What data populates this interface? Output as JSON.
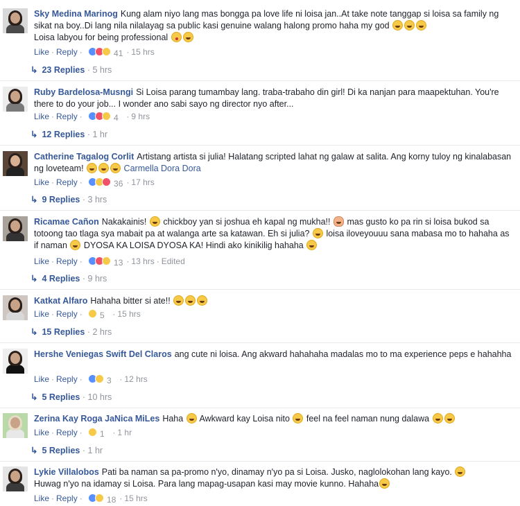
{
  "actions": {
    "like": "Like",
    "reply": "Reply",
    "dot": "·",
    "edited": "Edited"
  },
  "comments": [
    {
      "author": "Sky Medina Marinog",
      "text": "Kung alam niyo lang mas bongga pa love life ni loisa jan..At take note tanggap si loisa sa family ng sikat na boy..Di lang nila nilalayag sa public kasi genuine walang halong promo haha my god",
      "text2": "Loisa labyou for being professional",
      "reactions": "41",
      "time": "15 hrs",
      "replies": "23 Replies",
      "replies_time": "5 hrs"
    },
    {
      "author": "Ruby Bardelosa-Musngi",
      "text": "Si Loisa parang tumambay lang. traba-trabaho din girl! Di ka nanjan para maapektuhan. You're there to do your job... I wonder ano sabi sayo ng director nyo after...",
      "reactions": "4",
      "time": "9 hrs",
      "replies": "12 Replies",
      "replies_time": "1 hr"
    },
    {
      "author": "Catherine Tagalog Corlit",
      "text": "Artistang artista si julia! Halatang scripted lahat ng galaw at salita. Ang korny tuloy ng kinalabasan ng loveteam!",
      "mention": "Carmella Dora Dora",
      "reactions": "36",
      "time": "17 hrs",
      "replies": "9 Replies",
      "replies_time": "3 hrs"
    },
    {
      "author": "Ricamae Cañon",
      "text_a": "Nakakainis!",
      "text_b": "chickboy yan si joshua eh kapal ng mukha!!",
      "text_c": "mas gusto ko pa rin si loisa bukod sa totoong tao tlaga sya mabait pa at walanga arte sa katawan. Eh si julia?",
      "text_d": "loisa iloveyouuu sana mabasa mo to hahaha as if naman",
      "text_e": "DYOSA KA LOISA DYOSA KA! Hindi ako kinikilig hahaha",
      "reactions": "13",
      "time": "13 hrs",
      "replies": "4 Replies",
      "replies_time": "9 hrs"
    },
    {
      "author": "Katkat Alfaro",
      "text": "Hahaha bitter si ate!!",
      "reactions": "5",
      "time": "15 hrs",
      "replies": "15 Replies",
      "replies_time": "2 hrs"
    },
    {
      "author": "Hershe Veniegas Swift Del Claros",
      "text": "ang cute ni loisa. Ang akward hahahaha madalas mo to ma experience peps e hahahha",
      "reactions": "3",
      "time": "12 hrs",
      "replies": "5 Replies",
      "replies_time": "10 hrs"
    },
    {
      "author": "Zerina Kay Roga JaNica MiLes",
      "text_a": "Haha",
      "text_b": "Awkward kay Loisa nito",
      "text_c": "feel na feel naman nung dalawa",
      "reactions": "1",
      "time": "1 hr",
      "replies": "5 Replies",
      "replies_time": "1 hr"
    },
    {
      "author": "Lykie Villalobos",
      "text": "Pati ba naman sa pa-promo n'yo, dinamay n'yo pa si Loisa. Jusko, naglolokohan lang kayo.",
      "text2": "Huwag n'yo na idamay si Loisa. Para lang mapag-usapan kasi may movie kunno. Hahaha",
      "reactions": "18",
      "time": "15 hrs"
    }
  ]
}
